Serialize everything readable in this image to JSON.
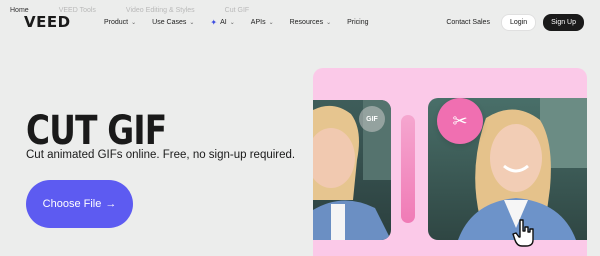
{
  "breadcrumb": {
    "home": "Home",
    "items": [
      "VEED Tools",
      "Video Editing & Styles",
      "Cut GIF"
    ]
  },
  "header": {
    "logo": "VEED",
    "nav": [
      {
        "label": "Product",
        "has_menu": true
      },
      {
        "label": "Use Cases",
        "has_menu": true
      },
      {
        "label": "AI",
        "has_menu": true
      },
      {
        "label": "APIs",
        "has_menu": true
      },
      {
        "label": "Resources",
        "has_menu": true
      },
      {
        "label": "Pricing",
        "has_menu": false
      }
    ],
    "contact_sales": "Contact Sales",
    "login": "Login",
    "signup": "Sign Up"
  },
  "hero": {
    "title": "CUT GIF",
    "subtitle": "Cut animated GIFs online. Free, no sign-up required.",
    "cta": "Choose File",
    "cta_arrow": "→"
  },
  "visual": {
    "gif_badge": "GIF",
    "scissor_icon": "✂"
  },
  "colors": {
    "background": "#ecedec",
    "cta": "#5d5bf1",
    "panel": "#fbc9e8",
    "accent_pink": "#f06fb1",
    "ai_star": "#3d4de0"
  }
}
